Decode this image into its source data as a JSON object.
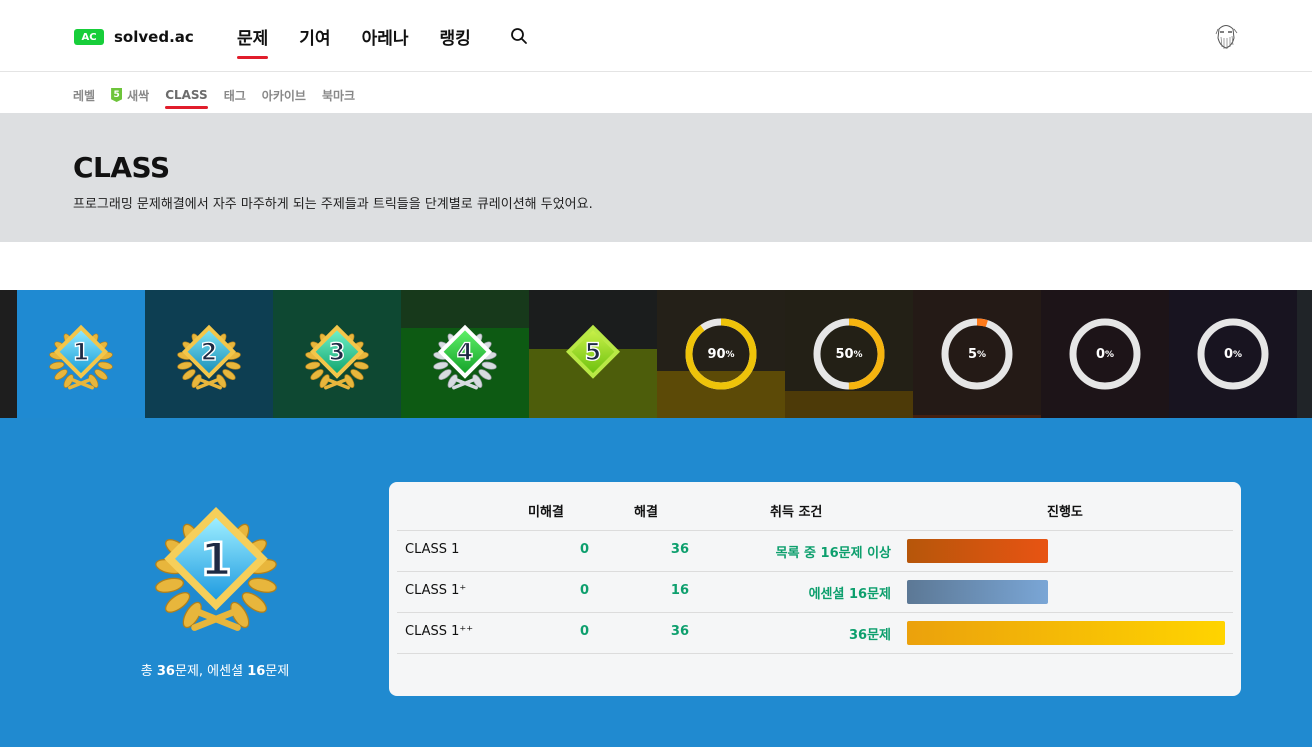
{
  "topbar": {
    "logo_badge": "AC",
    "logo_text": "solved.ac",
    "nav": [
      {
        "label": "문제",
        "active": true
      },
      {
        "label": "기여",
        "active": false
      },
      {
        "label": "아레나",
        "active": false
      },
      {
        "label": "랭킹",
        "active": false
      }
    ]
  },
  "subnav": {
    "items": [
      {
        "label": "레벨"
      },
      {
        "label": "새싹",
        "badge": "5"
      },
      {
        "label": "CLASS",
        "active": true
      },
      {
        "label": "태그"
      },
      {
        "label": "아카이브"
      },
      {
        "label": "북마크"
      }
    ]
  },
  "banner": {
    "title": "CLASS",
    "description": "프로그래밍 문제해결에서 자주 마주하게 되는 주제들과 트릭들을 단계별로 큐레이션해 두었어요."
  },
  "class_strip": {
    "badges": [
      {
        "label": "1",
        "selected": true,
        "bg": "#1f8ad2"
      },
      {
        "label": "2",
        "bg": "#0d3e52"
      },
      {
        "label": "3",
        "bg": "#0e4832"
      },
      {
        "label": "4",
        "bg": "#17391b",
        "fill_pct": 70,
        "fill_color": "#0d5a13"
      },
      {
        "label": "5",
        "bg": "#1b1d1d",
        "fill_pct": 54,
        "fill_color": "#4d5d0b"
      }
    ],
    "rings": [
      {
        "percent_label": "90",
        "unit": "%",
        "progress": 0.9,
        "color": "#eec30a",
        "bg": "#242018",
        "fill_pct": 37,
        "fill_color": "#5c4a07"
      },
      {
        "percent_label": "50",
        "unit": "%",
        "progress": 0.5,
        "color": "#f6b40f",
        "bg": "#232016",
        "fill_pct": 21,
        "fill_color": "#4d3a08"
      },
      {
        "percent_label": "5",
        "unit": "%",
        "progress": 0.05,
        "color": "#ff7a1a",
        "bg": "#241a16",
        "fill_pct": 2,
        "fill_color": "#442010"
      },
      {
        "percent_label": "0",
        "unit": "%",
        "progress": 0.0,
        "color": "#e05050",
        "bg": "#1d1418",
        "fill_pct": 0,
        "fill_color": "#1d1418"
      },
      {
        "percent_label": "0",
        "unit": "%",
        "progress": 0.0,
        "color": "#d04060",
        "bg": "#181420",
        "fill_pct": 0,
        "fill_color": "#181420"
      }
    ]
  },
  "detail": {
    "badge_label": "1",
    "summary_prefix": "총 ",
    "summary_total": "36",
    "summary_mid": "문제, 에센셜 ",
    "summary_essential": "16",
    "summary_suffix": "문제",
    "headers": {
      "unsolved": "미해결",
      "solved": "해결",
      "condition": "취득 조건",
      "progress": "진행도"
    },
    "rows": [
      {
        "name": "CLASS 1",
        "unsolved": "0",
        "solved": "36",
        "condition": "목록 중 16문제 이상",
        "progress": 0.444,
        "bar_from": "#b6560a",
        "bar_to": "#e85413"
      },
      {
        "name": "CLASS 1⁺",
        "unsolved": "0",
        "solved": "16",
        "condition": "에센셜 16문제",
        "progress": 0.444,
        "bar_from": "#5c7895",
        "bar_to": "#7aa6d6"
      },
      {
        "name": "CLASS 1⁺⁺",
        "unsolved": "0",
        "solved": "36",
        "condition": "36문제",
        "progress": 1.0,
        "bar_from": "#eba10c",
        "bar_to": "#ffd400"
      }
    ]
  }
}
